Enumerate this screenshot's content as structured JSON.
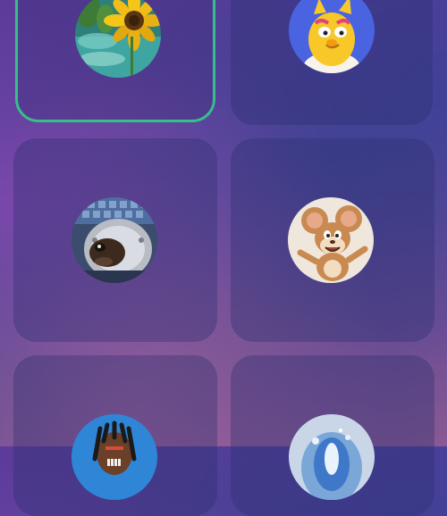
{
  "avatar_picker": {
    "selected_index": 0,
    "colors": {
      "selected_border": "#35c08a",
      "card_background": "#2d2f6e"
    },
    "avatars": [
      {
        "id": "avatar-sunflower",
        "label": ""
      },
      {
        "id": "avatar-yellow-bird",
        "label": ""
      },
      {
        "id": "avatar-helmet-dog",
        "label": ""
      },
      {
        "id": "avatar-jerry-mouse",
        "label": ""
      },
      {
        "id": "avatar-dreadlocks",
        "label": ""
      },
      {
        "id": "avatar-blue-splash",
        "label": ""
      }
    ]
  }
}
